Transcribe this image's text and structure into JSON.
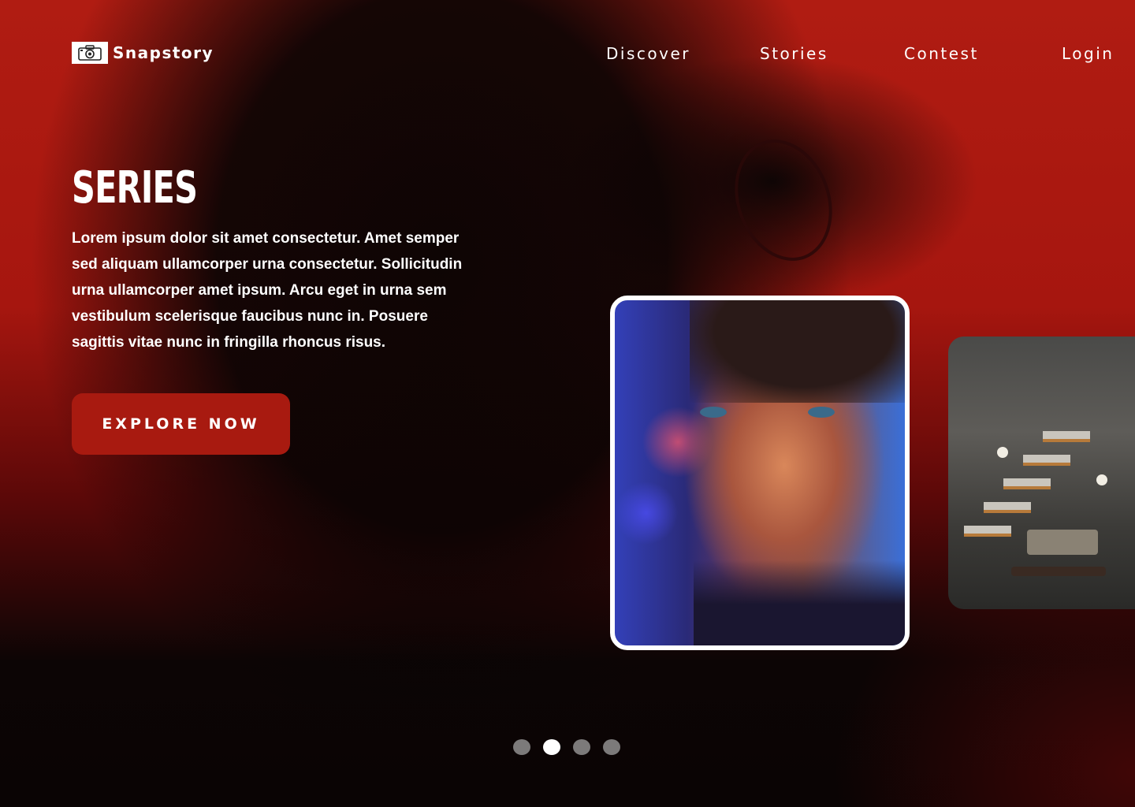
{
  "header": {
    "logo_text": "Snapstory",
    "logo_icon": "camera-icon",
    "nav": [
      "Discover",
      "Stories",
      "Contest",
      "Login"
    ]
  },
  "hero": {
    "title": "SERIES",
    "description": "Lorem ipsum dolor sit amet consectetur. Amet semper sed aliquam ullamcorper urna consectetur. Sollicitudin urna ullamcorper amet ipsum. Arcu eget in urna sem vestibulum scelerisque faucibus nunc in. Posuere sagittis vitae nunc in fringilla rhoncus risus.",
    "cta_label": "EXPLORE NOW"
  },
  "carousel": {
    "slides": [
      "portrait-photo",
      "interior-stairs-photo"
    ],
    "dots": 4,
    "active_dot": 2
  },
  "colors": {
    "accent": "#a81a10",
    "background_red": "#b01c12",
    "background_dark": "#0a0505"
  }
}
